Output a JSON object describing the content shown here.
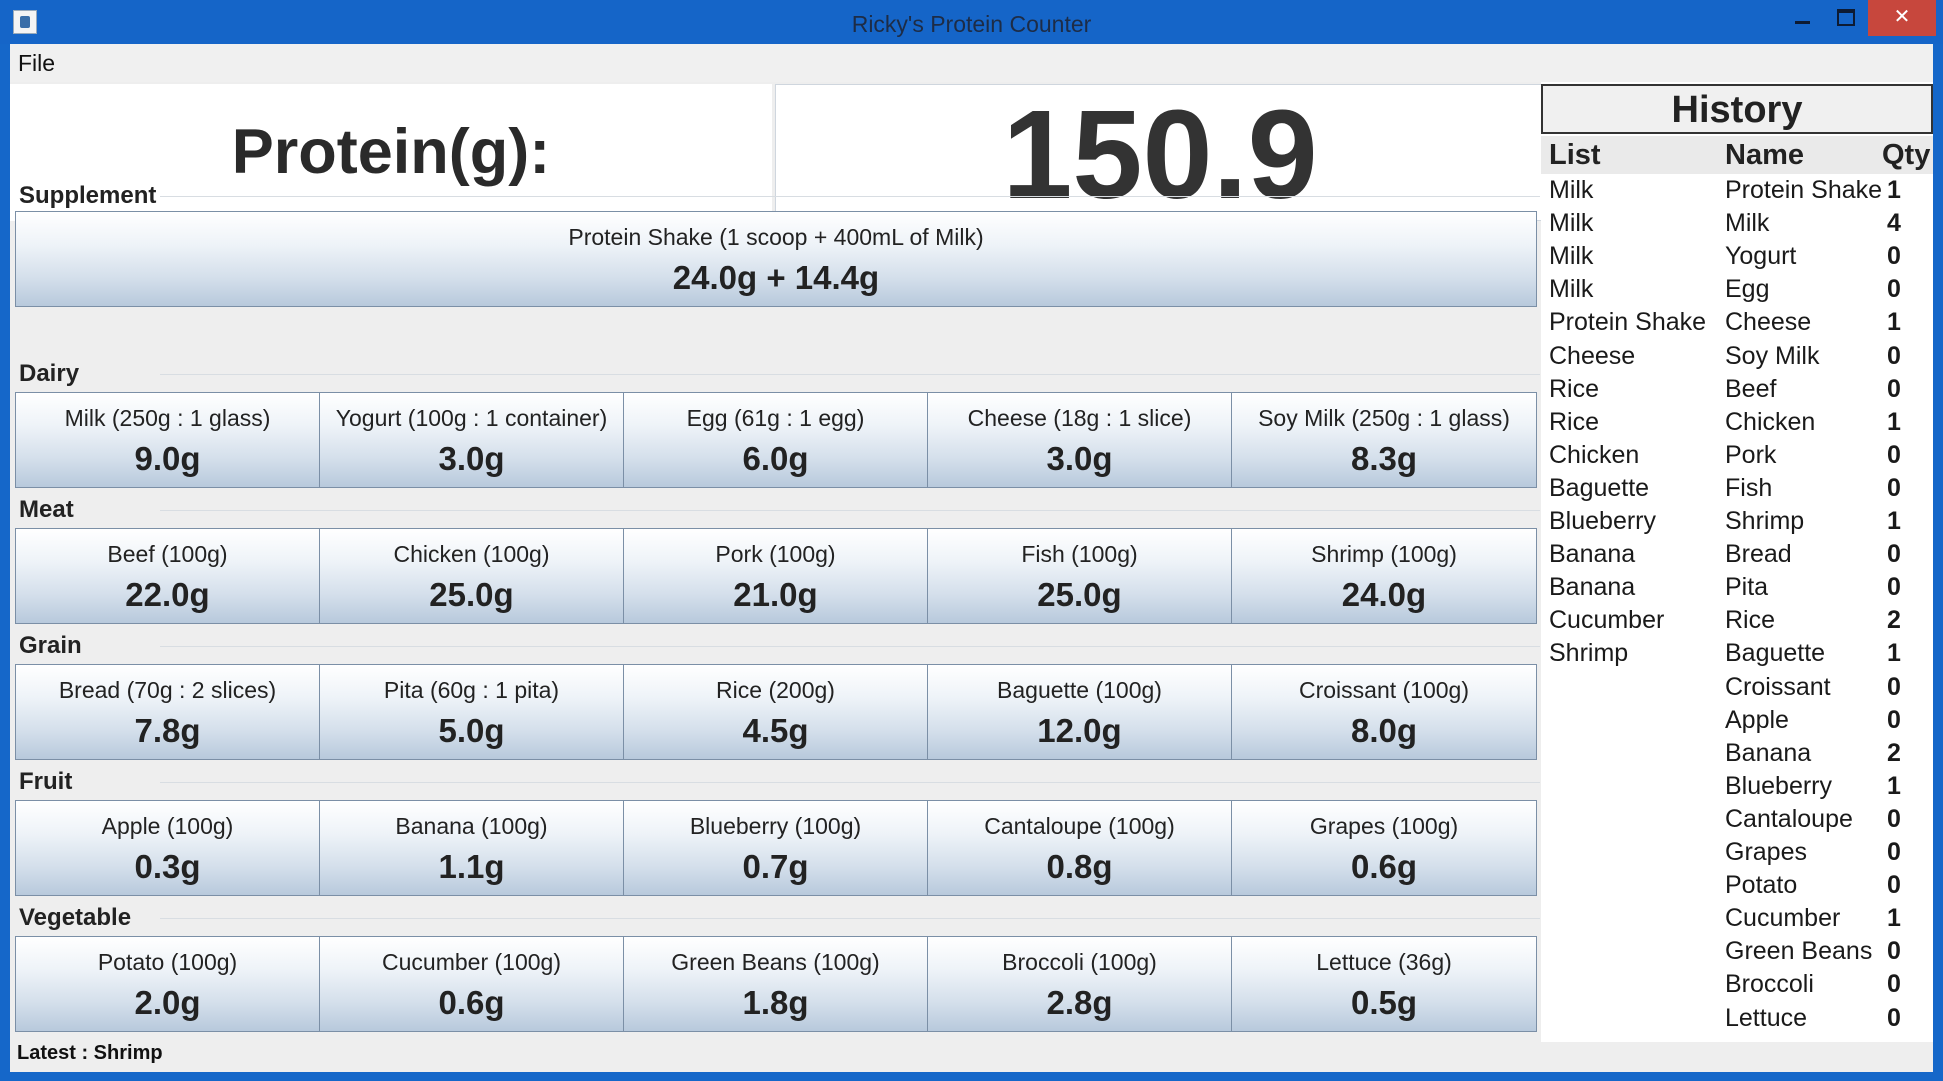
{
  "window": {
    "title": "Ricky's Protein Counter"
  },
  "menu": {
    "file": "File"
  },
  "protein": {
    "label": "Protein(g):",
    "value": "150.9"
  },
  "sections": [
    {
      "title": "Supplement",
      "items": [
        {
          "name": "Protein Shake (1 scoop + 400mL of Milk)",
          "value": "24.0g + 14.4g"
        }
      ]
    },
    {
      "title": "Dairy",
      "items": [
        {
          "name": "Milk (250g : 1 glass)",
          "value": "9.0g"
        },
        {
          "name": "Yogurt (100g : 1 container)",
          "value": "3.0g"
        },
        {
          "name": "Egg (61g : 1 egg)",
          "value": "6.0g"
        },
        {
          "name": "Cheese (18g : 1 slice)",
          "value": "3.0g"
        },
        {
          "name": "Soy Milk (250g : 1 glass)",
          "value": "8.3g"
        }
      ]
    },
    {
      "title": "Meat",
      "items": [
        {
          "name": "Beef (100g)",
          "value": "22.0g"
        },
        {
          "name": "Chicken (100g)",
          "value": "25.0g"
        },
        {
          "name": "Pork (100g)",
          "value": "21.0g"
        },
        {
          "name": "Fish (100g)",
          "value": "25.0g"
        },
        {
          "name": "Shrimp (100g)",
          "value": "24.0g"
        }
      ]
    },
    {
      "title": "Grain",
      "items": [
        {
          "name": "Bread (70g : 2 slices)",
          "value": "7.8g"
        },
        {
          "name": "Pita (60g : 1 pita)",
          "value": "5.0g"
        },
        {
          "name": "Rice (200g)",
          "value": "4.5g"
        },
        {
          "name": "Baguette (100g)",
          "value": "12.0g"
        },
        {
          "name": "Croissant (100g)",
          "value": "8.0g"
        }
      ]
    },
    {
      "title": "Fruit",
      "items": [
        {
          "name": "Apple (100g)",
          "value": "0.3g"
        },
        {
          "name": "Banana (100g)",
          "value": "1.1g"
        },
        {
          "name": "Blueberry (100g)",
          "value": "0.7g"
        },
        {
          "name": "Cantaloupe (100g)",
          "value": "0.8g"
        },
        {
          "name": "Grapes (100g)",
          "value": "0.6g"
        }
      ]
    },
    {
      "title": "Vegetable",
      "items": [
        {
          "name": "Potato (100g)",
          "value": "2.0g"
        },
        {
          "name": "Cucumber (100g)",
          "value": "0.6g"
        },
        {
          "name": "Green Beans (100g)",
          "value": "1.8g"
        },
        {
          "name": "Broccoli (100g)",
          "value": "2.8g"
        },
        {
          "name": "Lettuce (36g)",
          "value": "0.5g"
        }
      ]
    }
  ],
  "history": {
    "title": "History",
    "columns": {
      "list": "List",
      "name": "Name",
      "qty": "Qty"
    },
    "list": [
      "Milk",
      "Milk",
      "Milk",
      "Milk",
      "Protein Shake",
      "Cheese",
      "Rice",
      "Rice",
      "Chicken",
      "Baguette",
      "Blueberry",
      "Banana",
      "Banana",
      "Cucumber",
      "Shrimp"
    ],
    "names": [
      "Protein Shake",
      "Milk",
      "Yogurt",
      "Egg",
      "Cheese",
      "Soy Milk",
      "Beef",
      "Chicken",
      "Pork",
      "Fish",
      "Shrimp",
      "Bread",
      "Pita",
      "Rice",
      "Baguette",
      "Croissant",
      "Apple",
      "Banana",
      "Blueberry",
      "Cantaloupe",
      "Grapes",
      "Potato",
      "Cucumber",
      "Green Beans",
      "Broccoli",
      "Lettuce"
    ],
    "qty": [
      "1",
      "4",
      "0",
      "0",
      "1",
      "0",
      "0",
      "1",
      "0",
      "0",
      "1",
      "0",
      "0",
      "2",
      "1",
      "0",
      "0",
      "2",
      "1",
      "0",
      "0",
      "0",
      "1",
      "0",
      "0",
      "0"
    ]
  },
  "status": {
    "latest": "Latest : Shrimp"
  }
}
